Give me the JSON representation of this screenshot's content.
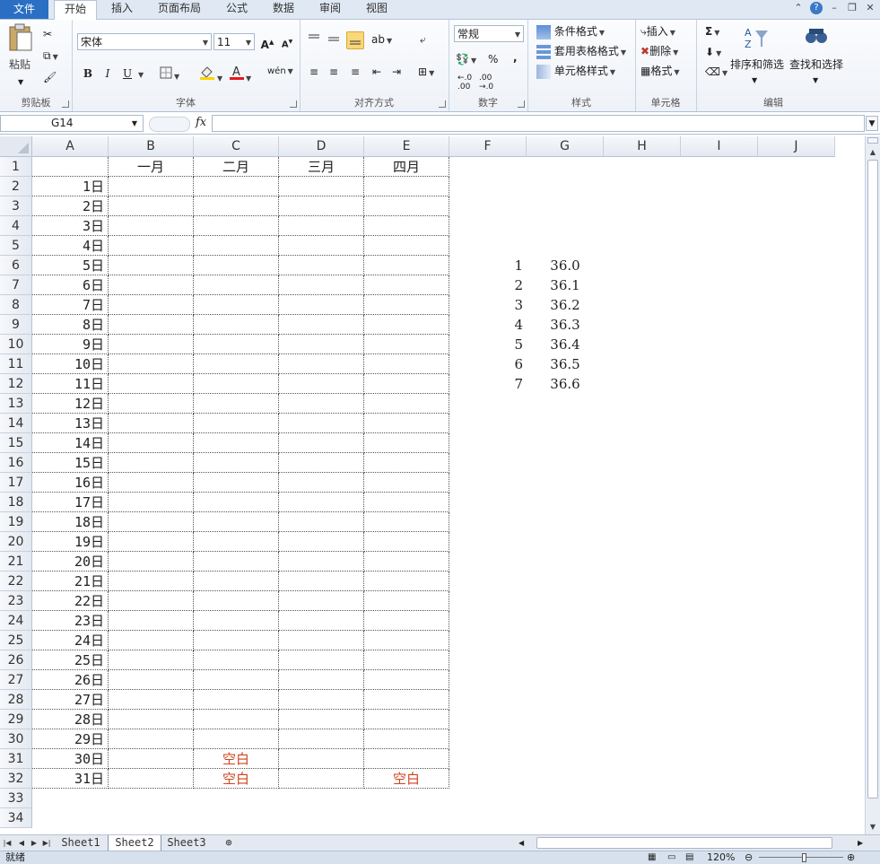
{
  "menu": {
    "file": "文件",
    "tabs": [
      "开始",
      "插入",
      "页面布局",
      "公式",
      "数据",
      "审阅",
      "视图"
    ],
    "active": "开始"
  },
  "ribbon": {
    "clipboard": {
      "label": "剪贴板",
      "paste": "粘贴"
    },
    "font": {
      "label": "字体",
      "name": "宋体",
      "size": "11",
      "bold": "B",
      "italic": "I",
      "underline": "U",
      "phonetic": "wén"
    },
    "alignment": {
      "label": "对齐方式"
    },
    "number": {
      "label": "数字",
      "format": "常规",
      "percent": "%",
      "comma": ","
    },
    "styles": {
      "label": "样式",
      "conditional": "条件格式",
      "table_format": "套用表格格式",
      "cell_styles": "单元格样式"
    },
    "cells": {
      "label": "单元格",
      "insert": "插入",
      "delete": "删除",
      "format": "格式"
    },
    "editing": {
      "label": "编辑",
      "sort_filter": "排序和筛选",
      "find_select": "查找和选择",
      "sigma": "Σ"
    }
  },
  "formula_bar": {
    "name_box": "G14",
    "fx": "fx",
    "formula": ""
  },
  "grid": {
    "columns": [
      "A",
      "B",
      "C",
      "D",
      "E",
      "F",
      "G",
      "H",
      "I",
      "J"
    ],
    "rows": [
      "1",
      "2",
      "3",
      "4",
      "5",
      "6",
      "7",
      "8",
      "9",
      "10",
      "11",
      "12",
      "13",
      "14",
      "15",
      "16",
      "17",
      "18",
      "19",
      "20",
      "21",
      "22",
      "23",
      "24",
      "25",
      "26",
      "27",
      "28",
      "29",
      "30",
      "31",
      "32",
      "33",
      "34"
    ],
    "month_headers": [
      "一月",
      "二月",
      "三月",
      "四月"
    ],
    "day_labels": [
      "1日",
      "2日",
      "3日",
      "4日",
      "5日",
      "6日",
      "7日",
      "8日",
      "9日",
      "10日",
      "11日",
      "12日",
      "13日",
      "14日",
      "15日",
      "16日",
      "17日",
      "18日",
      "19日",
      "20日",
      "21日",
      "22日",
      "23日",
      "24日",
      "25日",
      "26日",
      "27日",
      "28日",
      "29日",
      "30日",
      "31日"
    ],
    "blank_text": "空白",
    "side_list": [
      {
        "n": "1",
        "v": "36.0"
      },
      {
        "n": "2",
        "v": "36.1"
      },
      {
        "n": "3",
        "v": "36.2"
      },
      {
        "n": "4",
        "v": "36.3"
      },
      {
        "n": "5",
        "v": "36.4"
      },
      {
        "n": "6",
        "v": "36.5"
      },
      {
        "n": "7",
        "v": "36.6"
      }
    ]
  },
  "sheets": {
    "tabs": [
      "Sheet1",
      "Sheet2",
      "Sheet3"
    ],
    "active": "Sheet2"
  },
  "status": {
    "text": "就绪",
    "zoom": "120%"
  },
  "colors": {
    "red_text": "#d0421b",
    "file_tab": "#2a6fc4"
  }
}
